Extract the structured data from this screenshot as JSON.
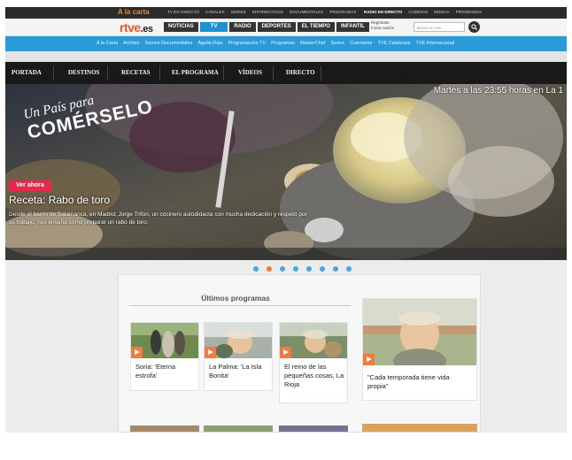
{
  "topbar": {
    "alacarta": "A la carta",
    "links": [
      "TV EN DIRECTO",
      "CANALES",
      "SERIES",
      "INFORMATIVOS",
      "DOCUMENTALES",
      "PROGRAMAS"
    ],
    "right_links": [
      "RADIO EN DIRECTO",
      "CADENAS",
      "MÚSICA",
      "PROGRAMAS"
    ]
  },
  "header": {
    "logo": "rtve",
    "logo_suffix": ".es",
    "nav": [
      "NOTICIAS",
      "TV",
      "RADIO",
      "DEPORTES",
      "EL TIEMPO",
      "INFANTIL"
    ],
    "register": "Regístrate",
    "login": "Iniciar sesión",
    "search_placeholder": "Busca en rtve"
  },
  "subnav": [
    "A la Carta",
    "Archivo",
    "Somos Documentales",
    "Águila Roja",
    "Programación TV",
    "Programas",
    "MasterChef",
    "Series",
    "Cuéntame",
    "TVE Catalunya",
    "TVE Internacional"
  ],
  "section_nav": [
    "PORTADA",
    "DESTINOS",
    "RECETAS",
    "EL PROGRAMA",
    "VÍDEOS",
    "DIRECTO"
  ],
  "hero": {
    "schedule": "Martes a las 23:55 horas en La 1",
    "brand_line1": "Un País para",
    "brand_line2": "COMÉRSELO",
    "cta": "Ver ahora",
    "title": "Receta: Rabo de toro",
    "description": "Desde el barrio de Salamanca, en Madrid, Jorge Trifon, un cocinero autodidacta con mucha dedicación y respeto por su trabajo, nos enseña cómo preparar un rabo de toro."
  },
  "carousel": {
    "count": 8,
    "active": 2
  },
  "programs": {
    "title": "Últimos programas",
    "items": [
      "Soria: 'Eterna estrofa'",
      "La Palma: 'La Isla Bonita'",
      "El reino de las pequeñas cosas, La Rioja"
    ],
    "featured": "\"Cada temporada tiene vida propia\""
  },
  "colors": {
    "accent_orange": "#f07b3f",
    "rtve_orange": "#e8572a",
    "tv_blue": "#1f8fd6",
    "subnav_blue": "#2b9ad8",
    "cta_red": "#e8284a"
  }
}
